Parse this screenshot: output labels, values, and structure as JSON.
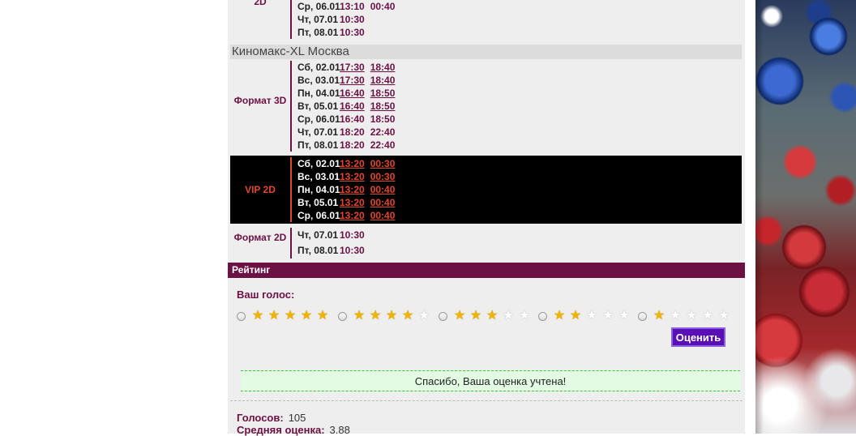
{
  "top_block": {
    "label_fragment": "2D",
    "sessions": [
      {
        "day": "Ср, 06.01",
        "times": [
          "13:10",
          "00:40"
        ]
      },
      {
        "day": "Чт, 07.01",
        "times": [
          "10:30"
        ]
      },
      {
        "day": "Пт, 08.01",
        "times": [
          "10:30"
        ]
      }
    ]
  },
  "cinema": {
    "name": "Киномакс-XL Москва",
    "blocks": [
      {
        "format": "Формат 3D",
        "sessions": [
          {
            "day": "Сб, 02.01",
            "times": [
              {
                "t": "17:30",
                "link": true
              },
              {
                "t": "18:40",
                "link": true
              }
            ]
          },
          {
            "day": "Вс, 03.01",
            "times": [
              {
                "t": "17:30",
                "link": true
              },
              {
                "t": "18:40",
                "link": true
              }
            ]
          },
          {
            "day": "Пн, 04.01",
            "times": [
              {
                "t": "16:40",
                "link": true
              },
              {
                "t": "18:50",
                "link": true
              }
            ]
          },
          {
            "day": "Вт, 05.01",
            "times": [
              {
                "t": "16:40",
                "link": true
              },
              {
                "t": "18:50",
                "link": true
              }
            ]
          },
          {
            "day": "Ср, 06.01",
            "times": [
              {
                "t": "16:40",
                "link": false
              },
              {
                "t": "18:50",
                "link": false
              }
            ]
          },
          {
            "day": "Чт, 07.01",
            "times": [
              {
                "t": "18:20",
                "link": false
              },
              {
                "t": "22:40",
                "link": false
              }
            ]
          },
          {
            "day": "Пт, 08.01",
            "times": [
              {
                "t": "18:20",
                "link": false
              },
              {
                "t": "22:40",
                "link": false
              }
            ]
          }
        ]
      },
      {
        "format": "VIP 2D",
        "sessions": [
          {
            "day": "Сб, 02.01",
            "times": [
              {
                "t": "13:20",
                "link": true
              },
              {
                "t": "00:30",
                "link": true
              }
            ]
          },
          {
            "day": "Вс, 03.01",
            "times": [
              {
                "t": "13:20",
                "link": true
              },
              {
                "t": "00:30",
                "link": true
              }
            ]
          },
          {
            "day": "Пн, 04.01",
            "times": [
              {
                "t": "13:20",
                "link": true
              },
              {
                "t": "00:40",
                "link": true
              }
            ]
          },
          {
            "day": "Вт, 05.01",
            "times": [
              {
                "t": "13:20",
                "link": true
              },
              {
                "t": "00:40",
                "link": true
              }
            ]
          },
          {
            "day": "Ср, 06.01",
            "times": [
              {
                "t": "13:20",
                "link": true
              },
              {
                "t": "00:40",
                "link": true
              }
            ]
          }
        ]
      },
      {
        "format": "Формат 2D",
        "sessions": [
          {
            "day": "Чт, 07.01",
            "times": [
              {
                "t": "10:30",
                "link": false
              }
            ]
          },
          {
            "day": "Пт, 08.01",
            "times": [
              {
                "t": "10:30",
                "link": false
              }
            ]
          }
        ]
      }
    ]
  },
  "rating": {
    "header": "Рейтинг",
    "vote_label": "Ваш голос:",
    "options": [
      5,
      4,
      3,
      2,
      1
    ],
    "submit_label": "Оценить",
    "thanks_message": "Спасибо, Ваша оценка учтена!",
    "votes_label": "Голосов:",
    "votes_value": "105",
    "average_label": "Средняя оценка:",
    "average_value": "3.88"
  },
  "colors": {
    "accent": "#6b1144",
    "vip_accent": "#e0482c",
    "button": "#5a0fb5"
  }
}
